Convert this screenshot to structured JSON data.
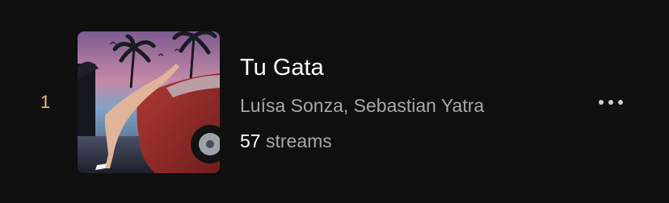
{
  "track": {
    "rank": "1",
    "title": "Tu Gata",
    "artists": "Luísa Sonza, Sebastian Yatra",
    "streams_count": "57",
    "streams_label": "streams",
    "album_art_icon": "album-cover",
    "more_icon": "more-horizontal-icon"
  },
  "colors": {
    "background": "#0f0f0f",
    "rank": "#e9c46a",
    "title": "#ffffff",
    "secondary_text": "#a7a7a7"
  }
}
